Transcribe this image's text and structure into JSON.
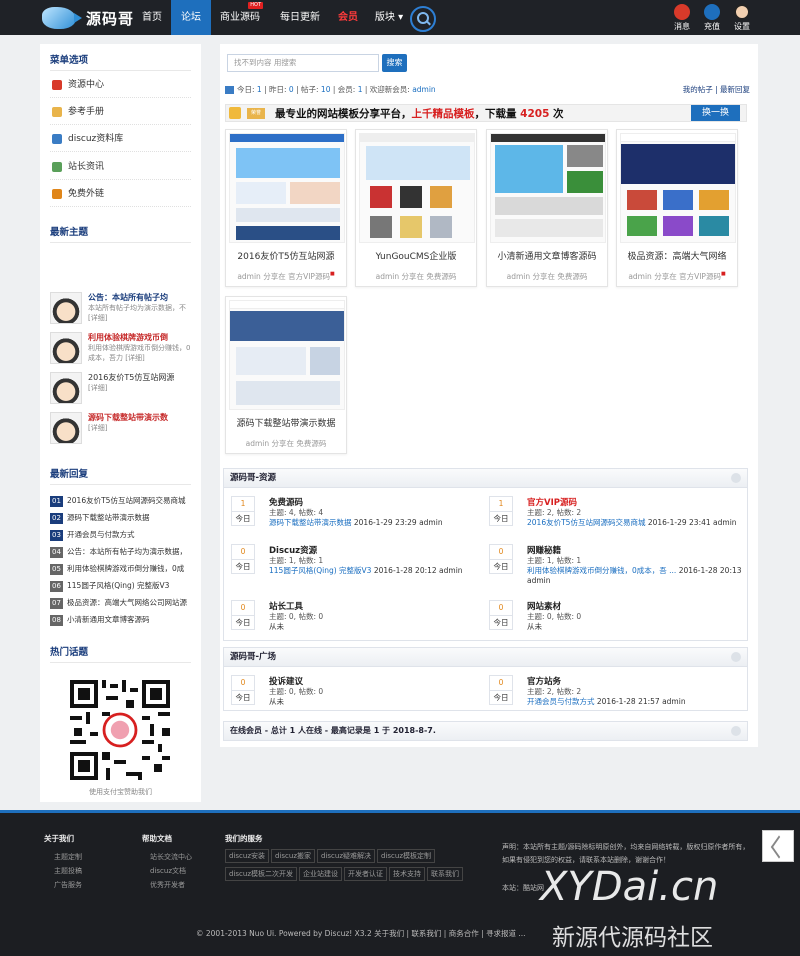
{
  "header": {
    "logo_text": "源码哥",
    "nav": [
      "首页",
      "论坛",
      "商业源码",
      "每日更新",
      "会员",
      "版块"
    ],
    "nav_hot_badge": "HOT",
    "icons": [
      {
        "label": "消息",
        "icon": "message-icon",
        "color": "#d83a2a"
      },
      {
        "label": "充值",
        "icon": "recharge-icon",
        "color": "#1e6fbd"
      },
      {
        "label": "设置",
        "icon": "settings-avatar-icon",
        "color": "#f2d0b0"
      }
    ]
  },
  "sidebar": {
    "menu_title": "菜单选项",
    "menu": [
      {
        "label": "资源中心",
        "icon": "resource-icon",
        "color": "#d83a2a"
      },
      {
        "label": "参考手册",
        "icon": "manual-icon",
        "color": "#e9b44b"
      },
      {
        "label": "discuz资料库",
        "icon": "library-icon",
        "color": "#3a7cc4"
      },
      {
        "label": "站长资讯",
        "icon": "news-icon",
        "color": "#5aa05a"
      },
      {
        "label": "免费外链",
        "icon": "link-icon",
        "color": "#e0861a"
      }
    ],
    "latest_title": "最新主题",
    "topics": [
      {
        "title": "公告：本站所有帖子均",
        "desc": "本站所有帖子均为演示数据，不 [详细]",
        "style": "blue"
      },
      {
        "title": "利用体验棋牌游戏币倒",
        "desc": "利用体验棋牌游戏币倒分赚钱，0成本，吾力 [详细]",
        "style": "red"
      },
      {
        "title": "2016友价T5仿互站网源",
        "desc": "[详细]",
        "style": "plain"
      },
      {
        "title": "源码下载整站带演示数",
        "desc": "[详细]",
        "style": "red"
      }
    ],
    "reply_title": "最新回复",
    "replies": [
      {
        "n": "01",
        "text": "2016友价T5仿互站网源码交易商城"
      },
      {
        "n": "02",
        "text": "源码下载整站带演示数据"
      },
      {
        "n": "03",
        "text": "开通会员与付款方式"
      },
      {
        "n": "04",
        "text": "公告：本站所有帖子均为演示数据，"
      },
      {
        "n": "05",
        "text": "利用体验棋牌游戏币倒分赚钱，0成"
      },
      {
        "n": "06",
        "text": "115圆子风格(Qing) 完整版V3"
      },
      {
        "n": "07",
        "text": "极品资源：高端大气网络公司网站源"
      },
      {
        "n": "08",
        "text": "小清新通用文章博客源码"
      }
    ],
    "hot_title": "热门话题",
    "qr_caption": "使用支付宝赞助我们"
  },
  "main": {
    "search_placeholder": "找不到内容 用搜索",
    "search_button": "搜索",
    "stats": {
      "today_label": "今日: ",
      "today": "1",
      "yesterday_label": " | 昨日: ",
      "yesterday": "0",
      "posts_label": " | 帖子: ",
      "posts": "10",
      "members_label": " | 会员: ",
      "members": "1",
      "newest_label": " | 欢迎新会员: ",
      "newest": "admin"
    },
    "links": "我的帖子 | 最新回复",
    "banner": {
      "tag": "荣誉",
      "text1": "最专业的网站模板分享平台，",
      "text2": "上千精品模板",
      "text3": "，下载量 ",
      "count": "4205",
      "text4": " 次",
      "change": "换一换"
    },
    "cards": [
      {
        "title": "2016友价T5仿互站网源",
        "meta": "admin 分享在 官方VIP源码",
        "vip": true
      },
      {
        "title": "YunGouCMS企业版",
        "meta": "admin 分享在 免费源码",
        "vip": false
      },
      {
        "title": "小清新通用文章博客源码",
        "meta": "admin 分享在 免费源码",
        "vip": false
      },
      {
        "title": "极品资源：高端大气网络",
        "meta": "admin 分享在 官方VIP源码",
        "vip": true
      },
      {
        "title": "源码下载整站带演示数据",
        "meta": "admin 分享在 免费源码",
        "vip": false
      }
    ],
    "section1": {
      "title": "源码哥-资源",
      "forums": [
        {
          "count": "1",
          "day": "今日",
          "name": "免费源码",
          "stat": "主题: 4, 帖数: 4",
          "last_link": "源码下载整站带演示数据",
          "last_meta": " 2016-1-29 23:29 admin",
          "red": false
        },
        {
          "count": "1",
          "day": "今日",
          "name": "官方VIP源码",
          "stat": "主题: 2, 帖数: 2",
          "last_link": "2016友价T5仿互站网源码交易商城",
          "last_meta": " 2016-1-29 23:41 admin",
          "red": true
        },
        {
          "count": "0",
          "day": "今日",
          "name": "Discuz资源",
          "stat": "主题: 1, 帖数: 1",
          "last_link": "115圆子风格(Qing) 完整版V3",
          "last_meta": " 2016-1-28 20:12 admin",
          "red": false
        },
        {
          "count": "0",
          "day": "今日",
          "name": "网赚秘籍",
          "stat": "主题: 1, 帖数: 1",
          "last_link": "利用体验棋牌游戏币倒分赚钱，0成本，吾 ...",
          "last_meta": " 2016-1-28 20:13 admin",
          "red": false
        },
        {
          "count": "0",
          "day": "今日",
          "name": "站长工具",
          "stat": "主题: 0, 帖数: 0",
          "last_link": "",
          "last_meta": "从未",
          "red": false
        },
        {
          "count": "0",
          "day": "今日",
          "name": "网站素材",
          "stat": "主题: 0, 帖数: 0",
          "last_link": "",
          "last_meta": "从未",
          "red": false
        }
      ]
    },
    "section2": {
      "title": "源码哥-广场",
      "forums": [
        {
          "count": "0",
          "day": "今日",
          "name": "投诉建议",
          "stat": "主题: 0, 帖数: 0",
          "last_link": "",
          "last_meta": "从未",
          "red": false
        },
        {
          "count": "0",
          "day": "今日",
          "name": "官方站务",
          "stat": "主题: 2, 帖数: 2",
          "last_link": "开通会员与付款方式",
          "last_meta": " 2016-1-28 21:57 admin",
          "red": false
        }
      ]
    },
    "online": "在线会员 - 总计 1 人在线 - 最高记录是 1 于 2018-8-7."
  },
  "footer": {
    "col1": {
      "title": "关于我们",
      "items": [
        "主题定制",
        "主题投稿",
        "广告服务"
      ]
    },
    "col2": {
      "title": "帮助文档",
      "items": [
        "站长交流中心",
        "discuz文档",
        "优秀开发者"
      ]
    },
    "col3": {
      "title": "我们的服务",
      "tags": [
        "discuz安装",
        "discuz搬家",
        "discuz疑难解决",
        "discuz模板定制",
        "discuz模板二次开发",
        "企业站建设",
        "开发者认证",
        "技术支持",
        "联系我们"
      ]
    },
    "note": "声明：本站所有主题/源码除标明原创外，均来自网络转载，版权归原作者所有，如果有侵犯到您的权益，请联系本站删除，谢谢合作！",
    "site": "本站：酷站网",
    "copyright": "© 2001-2013 Nuo Ui. Powered by Discuz! X3.2 关于我们  |  联系我们  |  商务合作  |  寻求报道 ..."
  },
  "watermark": {
    "line1": "XYDai.cn",
    "line2": "新源代源码社区"
  }
}
